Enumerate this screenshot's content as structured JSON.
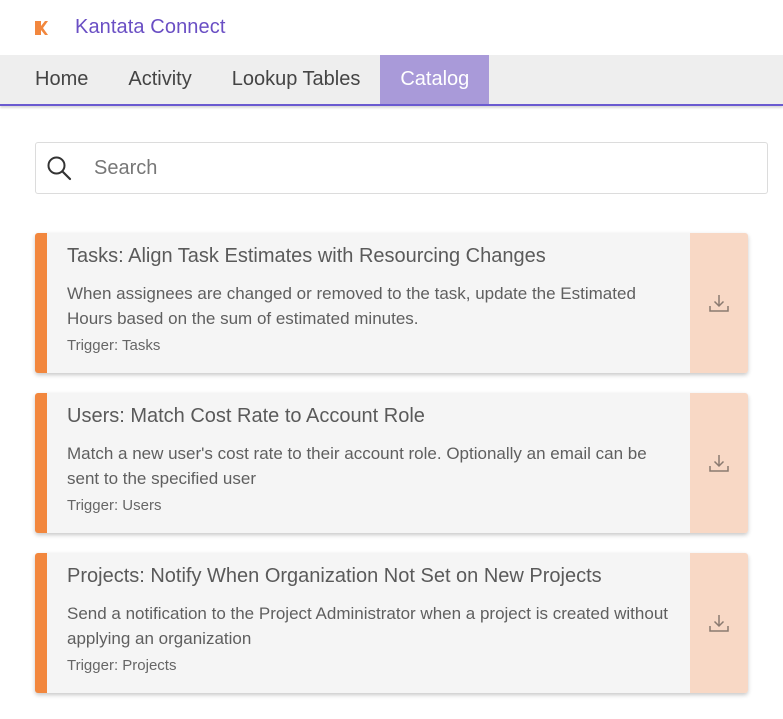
{
  "app": {
    "title": "Kantata Connect",
    "logo_icon": "kantata-k-logo",
    "brand_color": "#6a4fc4",
    "accent_color": "#f2873e"
  },
  "nav": {
    "tabs": [
      {
        "label": "Home",
        "active": false
      },
      {
        "label": "Activity",
        "active": false
      },
      {
        "label": "Lookup Tables",
        "active": false
      },
      {
        "label": "Catalog",
        "active": true
      }
    ]
  },
  "search": {
    "placeholder": "Search",
    "value": "",
    "icon": "search-icon"
  },
  "catalog": {
    "items": [
      {
        "title": "Tasks: Align Task Estimates with Resourcing Changes",
        "description": "When assignees are changed or removed to the task, update the Estimated Hours based on the sum of estimated minutes.",
        "trigger": "Trigger: Tasks",
        "action_icon": "download-icon"
      },
      {
        "title": "Users: Match Cost Rate to Account Role",
        "description": "Match a new user's cost rate to their account role. Optionally an email can be sent to the specified user",
        "trigger": "Trigger: Users",
        "action_icon": "download-icon"
      },
      {
        "title": "Projects: Notify When Organization Not Set on New Projects",
        "description": "Send a notification to the Project Administrator when a project is created without applying an organization",
        "trigger": "Trigger: Projects",
        "action_icon": "download-icon"
      }
    ]
  }
}
